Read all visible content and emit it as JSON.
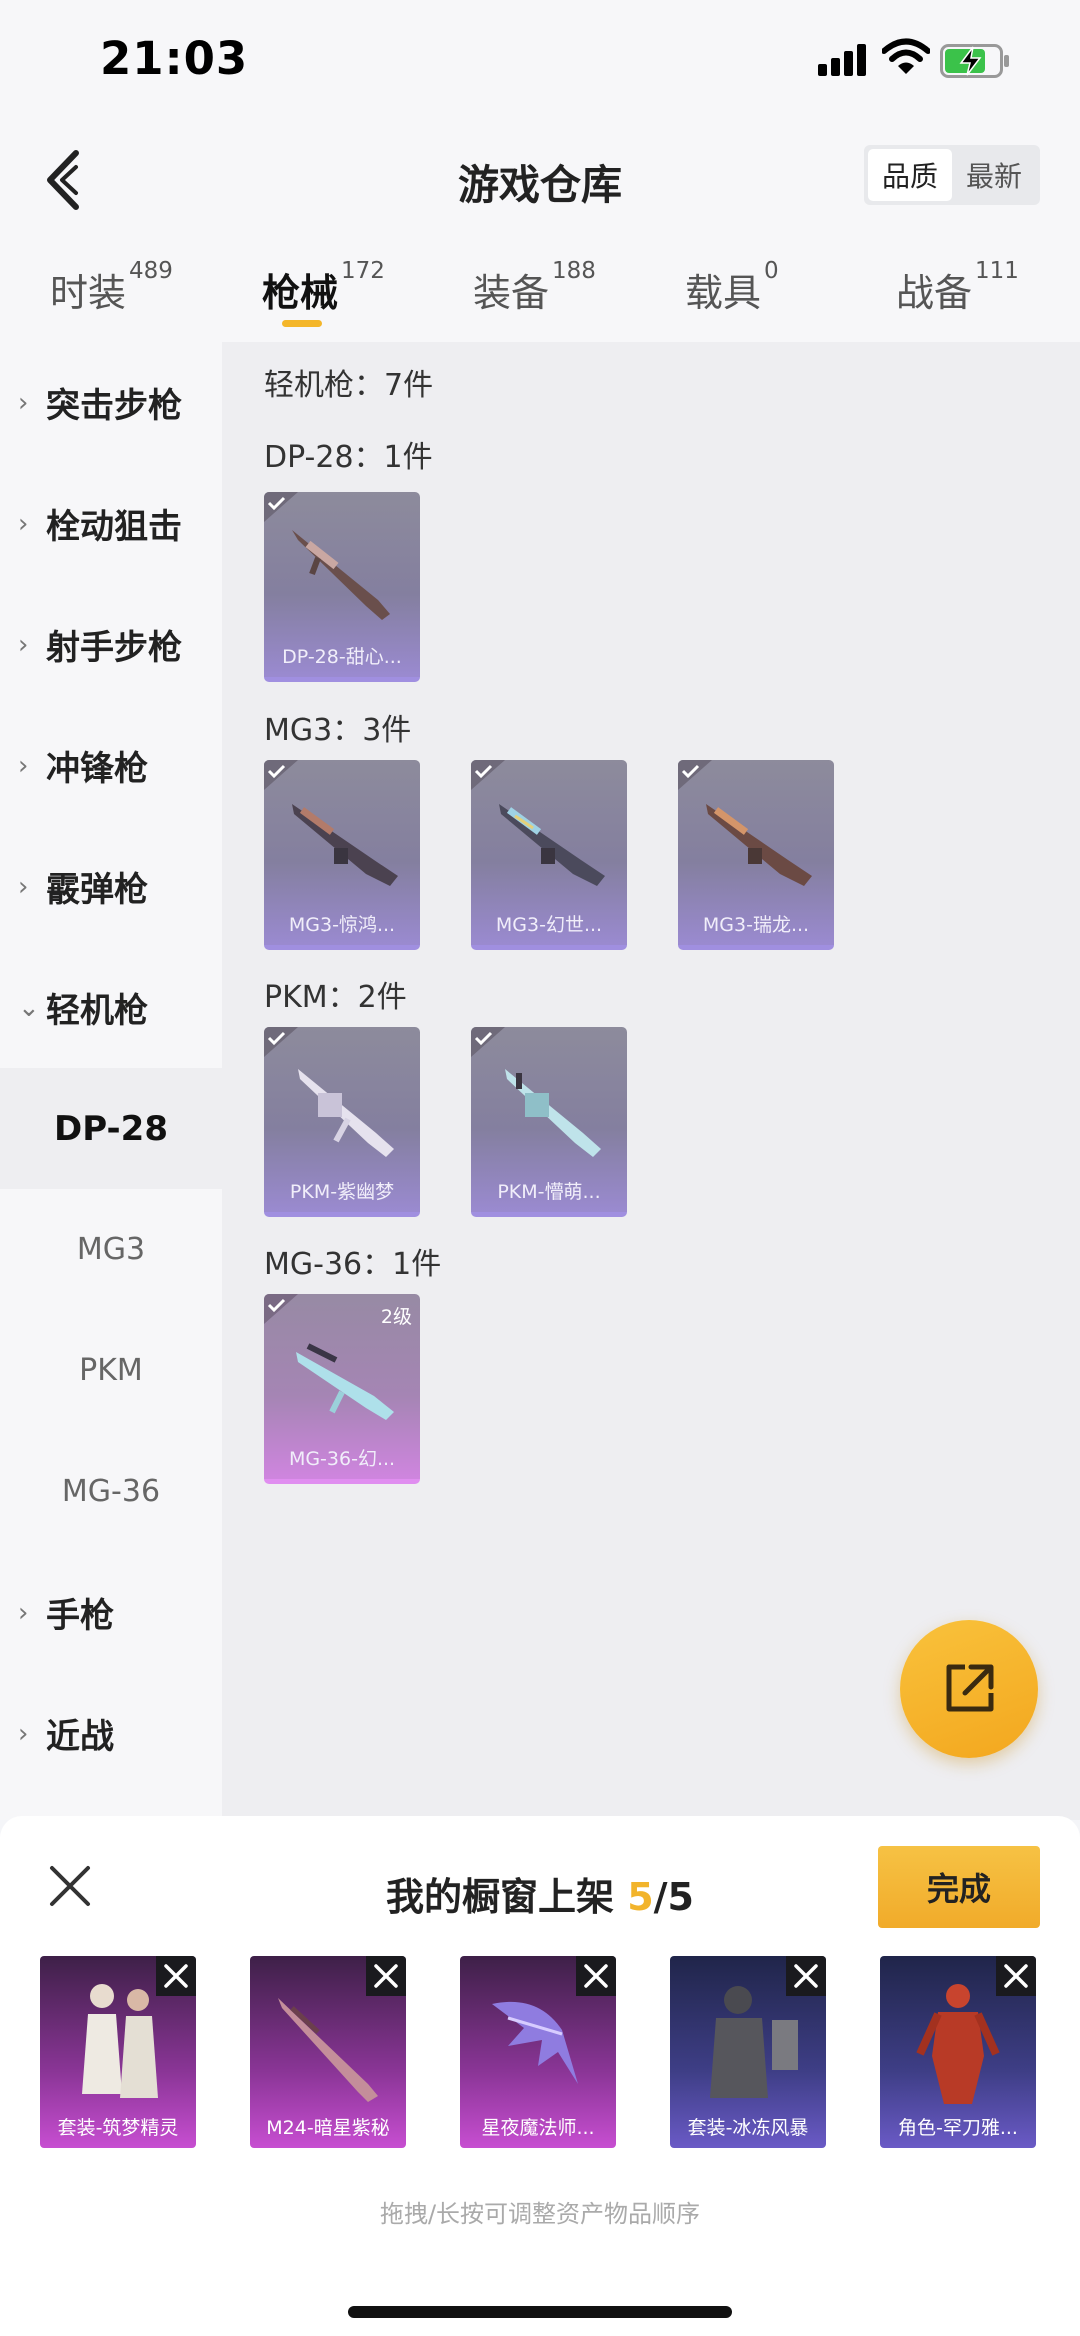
{
  "status_bar": {
    "time": "21:03"
  },
  "header": {
    "title": "游戏仓库",
    "sort_options": [
      "品质",
      "最新"
    ],
    "active_sort": "品质"
  },
  "tabs": [
    {
      "label": "时装",
      "count": "489"
    },
    {
      "label": "枪械",
      "count": "172"
    },
    {
      "label": "装备",
      "count": "188"
    },
    {
      "label": "载具",
      "count": "0"
    },
    {
      "label": "战备",
      "count": "111"
    }
  ],
  "sidebar": {
    "categories": [
      {
        "label": "突击步枪",
        "chevron": "›"
      },
      {
        "label": "栓动狙击",
        "chevron": "›"
      },
      {
        "label": "射手步枪",
        "chevron": "›"
      },
      {
        "label": "冲锋枪",
        "chevron": "›"
      },
      {
        "label": "霰弹枪",
        "chevron": "›"
      },
      {
        "label": "轻机枪",
        "chevron": "⌄"
      }
    ],
    "subitems": [
      "DP-28",
      "MG3",
      "PKM",
      "MG-36"
    ],
    "categories_after": [
      {
        "label": "手枪",
        "chevron": "›"
      },
      {
        "label": "近战",
        "chevron": "›"
      }
    ]
  },
  "content": {
    "section_title": "轻机枪：7件",
    "groups": [
      {
        "title": "DP-28：1件",
        "items": [
          {
            "name": "DP-28-甜心...",
            "rarity": "purple"
          }
        ]
      },
      {
        "title": "MG3：3件",
        "items": [
          {
            "name": "MG3-惊鸿...",
            "rarity": "purple"
          },
          {
            "name": "MG3-幻世...",
            "rarity": "purple"
          },
          {
            "name": "MG3-瑞龙...",
            "rarity": "purple"
          }
        ]
      },
      {
        "title": "PKM：2件",
        "items": [
          {
            "name": "PKM-紫幽梦",
            "rarity": "purple"
          },
          {
            "name": "PKM-懵萌...",
            "rarity": "purple"
          }
        ]
      },
      {
        "title": "MG-36：1件",
        "items": [
          {
            "name": "MG-36-幻...",
            "rarity": "pink",
            "level": "2级"
          }
        ]
      }
    ]
  },
  "showcase": {
    "title_prefix": "我的橱窗上架 ",
    "count_current": "5",
    "count_total": "/5",
    "done_label": "完成",
    "items": [
      {
        "name": "套装-筑梦精灵",
        "tone": "purple"
      },
      {
        "name": "M24-暗星紫秘",
        "tone": "purple"
      },
      {
        "name": "星夜魔法师...",
        "tone": "purple"
      },
      {
        "name": "套装-冰冻风暴",
        "tone": "blue"
      },
      {
        "name": "角色-罕刀雅...",
        "tone": "blue"
      }
    ],
    "hint": "拖拽/长按可调整资产物品顺序"
  },
  "colors": {
    "accent": "#f4b62a",
    "rarity_purple": "#a08fe0",
    "rarity_pink": "#e08ef0"
  }
}
